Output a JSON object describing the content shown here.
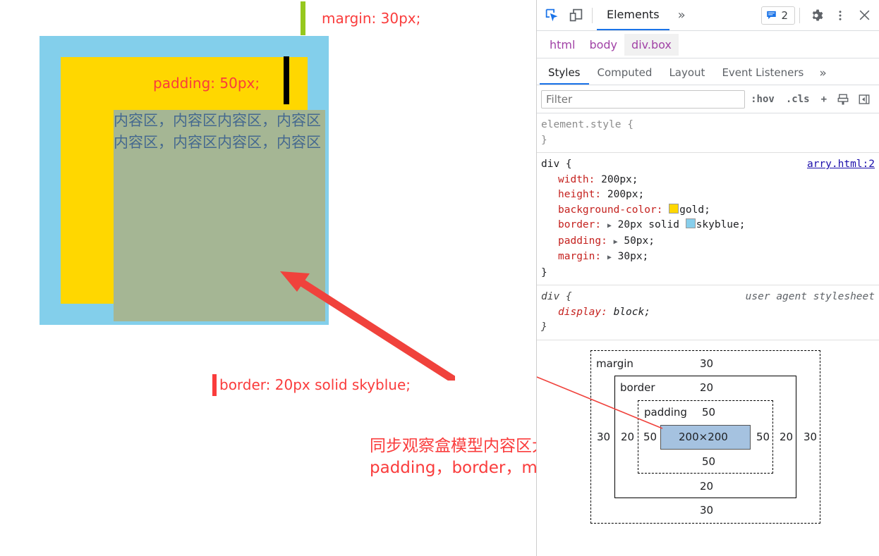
{
  "page": {
    "content_text": "内容区，内容区内容区，内容区内容区，内容区内容区，内容区",
    "labels": {
      "margin": "margin: 30px;",
      "padding": "padding: 50px;",
      "border": "border: 20px solid skyblue;"
    },
    "note_line1": "同步观察盒模型内容区大小",
    "note_line2": "padding，border，margin",
    "colors": {
      "border_color": "#83cfeb",
      "background_color": "#ffd700",
      "content_color": "#a5b694",
      "annotation_color": "#fa3c3c",
      "margin_bar": "#96c81e",
      "padding_bar": "#000000",
      "border_bar": "#fa3c3c"
    }
  },
  "devtools": {
    "toolbar": {
      "inspect_icon": "inspect-element-icon",
      "device_icon": "device-toolbar-icon",
      "active_tab": "Elements",
      "more_tabs": "»",
      "console_count": "2",
      "console_icon": "message-icon",
      "settings_icon": "gear-icon",
      "kebab_icon": "more-options-icon",
      "close_icon": "close-icon"
    },
    "breadcrumb": [
      "html",
      "body",
      "div.box"
    ],
    "breadcrumb_selected": "div.box",
    "style_tabs": [
      "Styles",
      "Computed",
      "Layout",
      "Event Listeners"
    ],
    "style_tabs_active": "Styles",
    "style_tabs_more": "»",
    "filter": {
      "placeholder": "Filter",
      "value": "",
      "hov": ":hov",
      "cls": ".cls",
      "plus": "+",
      "print_icon": "new-style-rule-icon",
      "sidebar_icon": "toggle-sidebar-icon"
    },
    "rules": [
      {
        "selector": "element.style {",
        "origin": "",
        "close": "}",
        "declarations": []
      },
      {
        "selector": "div {",
        "origin": "arry.html:2",
        "close": "}",
        "declarations": [
          {
            "name": "width",
            "value": "200px;",
            "swatch": "",
            "expand": false
          },
          {
            "name": "height",
            "value": "200px;",
            "swatch": "",
            "expand": false
          },
          {
            "name": "background-color",
            "value": "gold;",
            "swatch": "#ffd700",
            "expand": false
          },
          {
            "name": "border",
            "value": "20px solid ",
            "value2": "skyblue;",
            "swatch": "#87ceeb",
            "expand": true
          },
          {
            "name": "padding",
            "value": "50px;",
            "swatch": "",
            "expand": true
          },
          {
            "name": "margin",
            "value": "30px;",
            "swatch": "",
            "expand": true
          }
        ]
      },
      {
        "selector": "div {",
        "origin": "user agent stylesheet",
        "close": "}",
        "declarations": [
          {
            "name": "display",
            "value": "block;",
            "swatch": "",
            "expand": false
          }
        ]
      }
    ],
    "box_model": {
      "margin_label": "margin",
      "border_label": "border",
      "padding_label": "padding",
      "content_size": "200×200",
      "margin_top": "30",
      "margin_bottom": "30",
      "margin_left": "30",
      "margin_right": "30",
      "border_top": "20",
      "border_bottom": "20",
      "border_left": "20",
      "border_right": "20",
      "padding_top": "50",
      "padding_bottom": "50",
      "padding_left": "50",
      "padding_right": "50",
      "content_fill": "#a5c2e0"
    }
  }
}
